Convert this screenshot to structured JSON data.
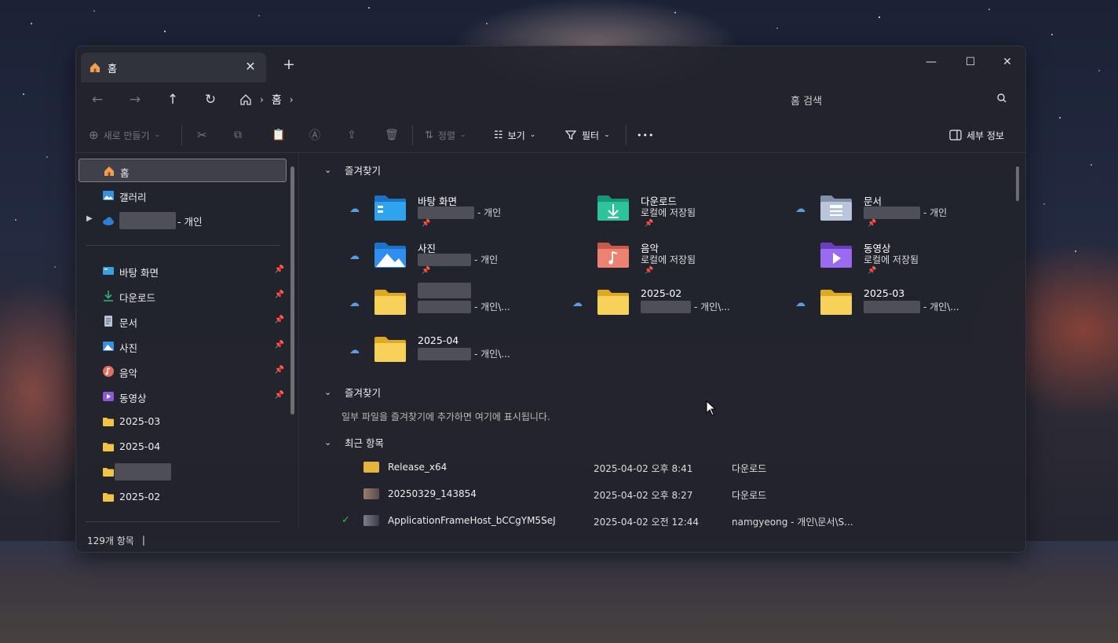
{
  "tab": {
    "title": "홈",
    "close": "✕",
    "new": "+"
  },
  "window_controls": {
    "minimize": "—",
    "maximize": "☐",
    "close": "✕"
  },
  "nav": {
    "back": "←",
    "forward": "→",
    "up": "↑",
    "refresh": "↻",
    "breadcrumb_home": "홈",
    "sep": "›"
  },
  "search": {
    "placeholder": "홈 검색"
  },
  "toolbar": {
    "new": "새로 만들기",
    "sort": "정렬",
    "view": "보기",
    "filter": "필터",
    "more": "•••",
    "details": "세부 정보"
  },
  "sidebar": {
    "home": "홈",
    "gallery": "갤러리",
    "onedrive_suffix": "- 개인",
    "pinned": [
      {
        "label": "바탕 화면",
        "icon": "desktop-icon",
        "color": "#3aa0e0"
      },
      {
        "label": "다운로드",
        "icon": "download-icon",
        "color": "#2fb37f"
      },
      {
        "label": "문서",
        "icon": "document-icon",
        "color": "#b7c3d6"
      },
      {
        "label": "사진",
        "icon": "pictures-icon",
        "color": "#3b8fe0"
      },
      {
        "label": "음악",
        "icon": "music-icon",
        "color": "#e07060"
      },
      {
        "label": "동영상",
        "icon": "video-icon",
        "color": "#8a5ad6"
      }
    ],
    "folders": [
      "2025-03",
      "2025-04",
      "",
      "2025-02"
    ]
  },
  "sections": {
    "quick_access": "즐겨찾기",
    "favorites": "즐겨찾기",
    "favorites_hint": "일부 파일을 즐겨찾기에 추가하면 여기에 표시됩니다.",
    "recent": "최근 항목"
  },
  "quick_access": [
    {
      "name": "바탕 화면",
      "sub": "- 개인",
      "cloud": true,
      "pinned": true,
      "icon": "desktop-folder-icon"
    },
    {
      "name": "다운로드",
      "sub": "로컬에 저장됨",
      "cloud": false,
      "pinned": true,
      "icon": "download-folder-icon"
    },
    {
      "name": "문서",
      "sub": "- 개인",
      "cloud": true,
      "pinned": true,
      "icon": "documents-folder-icon"
    },
    {
      "name": "사진",
      "sub": "- 개인",
      "cloud": true,
      "pinned": true,
      "icon": "pictures-folder-icon"
    },
    {
      "name": "음악",
      "sub": "로컬에 저장됨",
      "cloud": false,
      "pinned": true,
      "icon": "music-folder-icon"
    },
    {
      "name": "동영상",
      "sub": "로컬에 저장됨",
      "cloud": false,
      "pinned": true,
      "icon": "videos-folder-icon"
    },
    {
      "name": "",
      "sub": "- 개인\\...",
      "cloud": true,
      "pinned": false,
      "icon": "folder-icon"
    },
    {
      "name": "2025-02",
      "sub": "- 개인\\...",
      "cloud": true,
      "pinned": false,
      "icon": "folder-icon"
    },
    {
      "name": "2025-03",
      "sub": "- 개인\\...",
      "cloud": true,
      "pinned": false,
      "icon": "folder-icon"
    },
    {
      "name": "2025-04",
      "sub": "- 개인\\...",
      "cloud": true,
      "pinned": false,
      "icon": "folder-icon"
    }
  ],
  "recent": [
    {
      "name": "Release_x64",
      "date": "2025-04-02 오후 8:41",
      "location": "다운로드",
      "status": ""
    },
    {
      "name": "20250329_143854",
      "date": "2025-04-02 오후 8:27",
      "location": "다운로드",
      "status": ""
    },
    {
      "name": "ApplicationFrameHost_bCCgYM5SeJ",
      "date": "2025-04-02 오전 12:44",
      "location": "namgyeong - 개인\\문서\\S...",
      "status": "synced"
    }
  ],
  "status": {
    "count": "129개 항목",
    "sep": "|"
  }
}
